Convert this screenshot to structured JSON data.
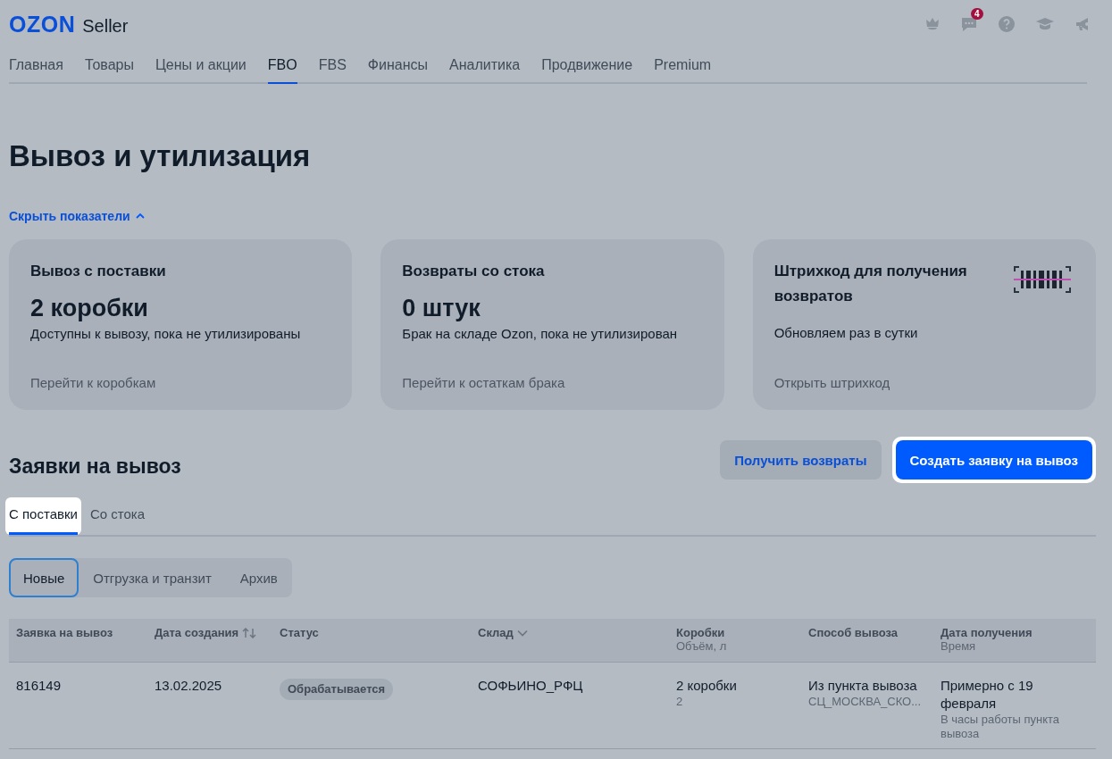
{
  "header": {
    "logo": "OZON",
    "logo_suffix": "Seller",
    "notifications_badge": "4"
  },
  "nav": [
    {
      "label": "Главная",
      "selected": false
    },
    {
      "label": "Товары",
      "selected": false
    },
    {
      "label": "Цены и акции",
      "selected": false
    },
    {
      "label": "FBO",
      "selected": true
    },
    {
      "label": "FBS",
      "selected": false
    },
    {
      "label": "Финансы",
      "selected": false
    },
    {
      "label": "Аналитика",
      "selected": false
    },
    {
      "label": "Продвижение",
      "selected": false
    },
    {
      "label": "Premium",
      "selected": false
    }
  ],
  "page_title": "Вывоз и утилизация",
  "toggle_link": {
    "label": "Скрыть показатели",
    "expanded": true
  },
  "cards": [
    {
      "title": "Вывоз с поставки",
      "value": "2 коробки",
      "description": "Доступны к вывозу, пока не утилизированы",
      "link": "Перейти к коробкам",
      "kind": "stat"
    },
    {
      "title": "Возвраты со стока",
      "value": "0 штук",
      "description": "Брак на складе Ozon, пока не утилизирован",
      "link": "Перейти к остаткам брака",
      "kind": "stat"
    },
    {
      "title": "Штрихкод для получения возвратов",
      "description": "Обновляем раз в сутки",
      "link": "Открыть штрихкод",
      "kind": "barcode"
    }
  ],
  "section_title": "Заявки на вывоз",
  "buttons": [
    {
      "label": "Получить возвраты",
      "kind": "secondary",
      "highlighted": false
    },
    {
      "label": "Создать заявку на вывоз",
      "kind": "primary",
      "highlighted": true
    }
  ],
  "tabs": [
    {
      "label": "С поставки",
      "selected": true,
      "highlighted": true
    },
    {
      "label": "Со стока",
      "selected": false,
      "highlighted": false
    }
  ],
  "filters": [
    {
      "label": "Новые",
      "selected": true
    },
    {
      "label": "Отгрузка и транзит",
      "selected": false
    },
    {
      "label": "Архив",
      "selected": false
    }
  ],
  "table": {
    "columns": [
      {
        "label": "Заявка на вывоз",
        "kind": "plain"
      },
      {
        "label": "Дата создания",
        "kind": "sort"
      },
      {
        "label": "Статус",
        "kind": "plain"
      },
      {
        "label": "Склад",
        "kind": "dropdown"
      },
      {
        "label": "Коробки",
        "sub": "Объём, л",
        "kind": "plain"
      },
      {
        "label": "Способ вывоза",
        "kind": "plain"
      },
      {
        "label": "Дата получения",
        "sub": "Время",
        "kind": "plain"
      }
    ],
    "rows": [
      {
        "id": "816149",
        "date": "13.02.2025",
        "status": "Обрабатывается",
        "warehouse": "СОФЬИНО_РФЦ",
        "boxes": "2 коробки",
        "volume": "2",
        "method": "Из пункта вывоза",
        "point": "СЦ_МОСКВА_СКО...",
        "receive_date": "Примерно с 19 февраля",
        "receive_time": "В часы работы пункта вывоза"
      }
    ]
  }
}
